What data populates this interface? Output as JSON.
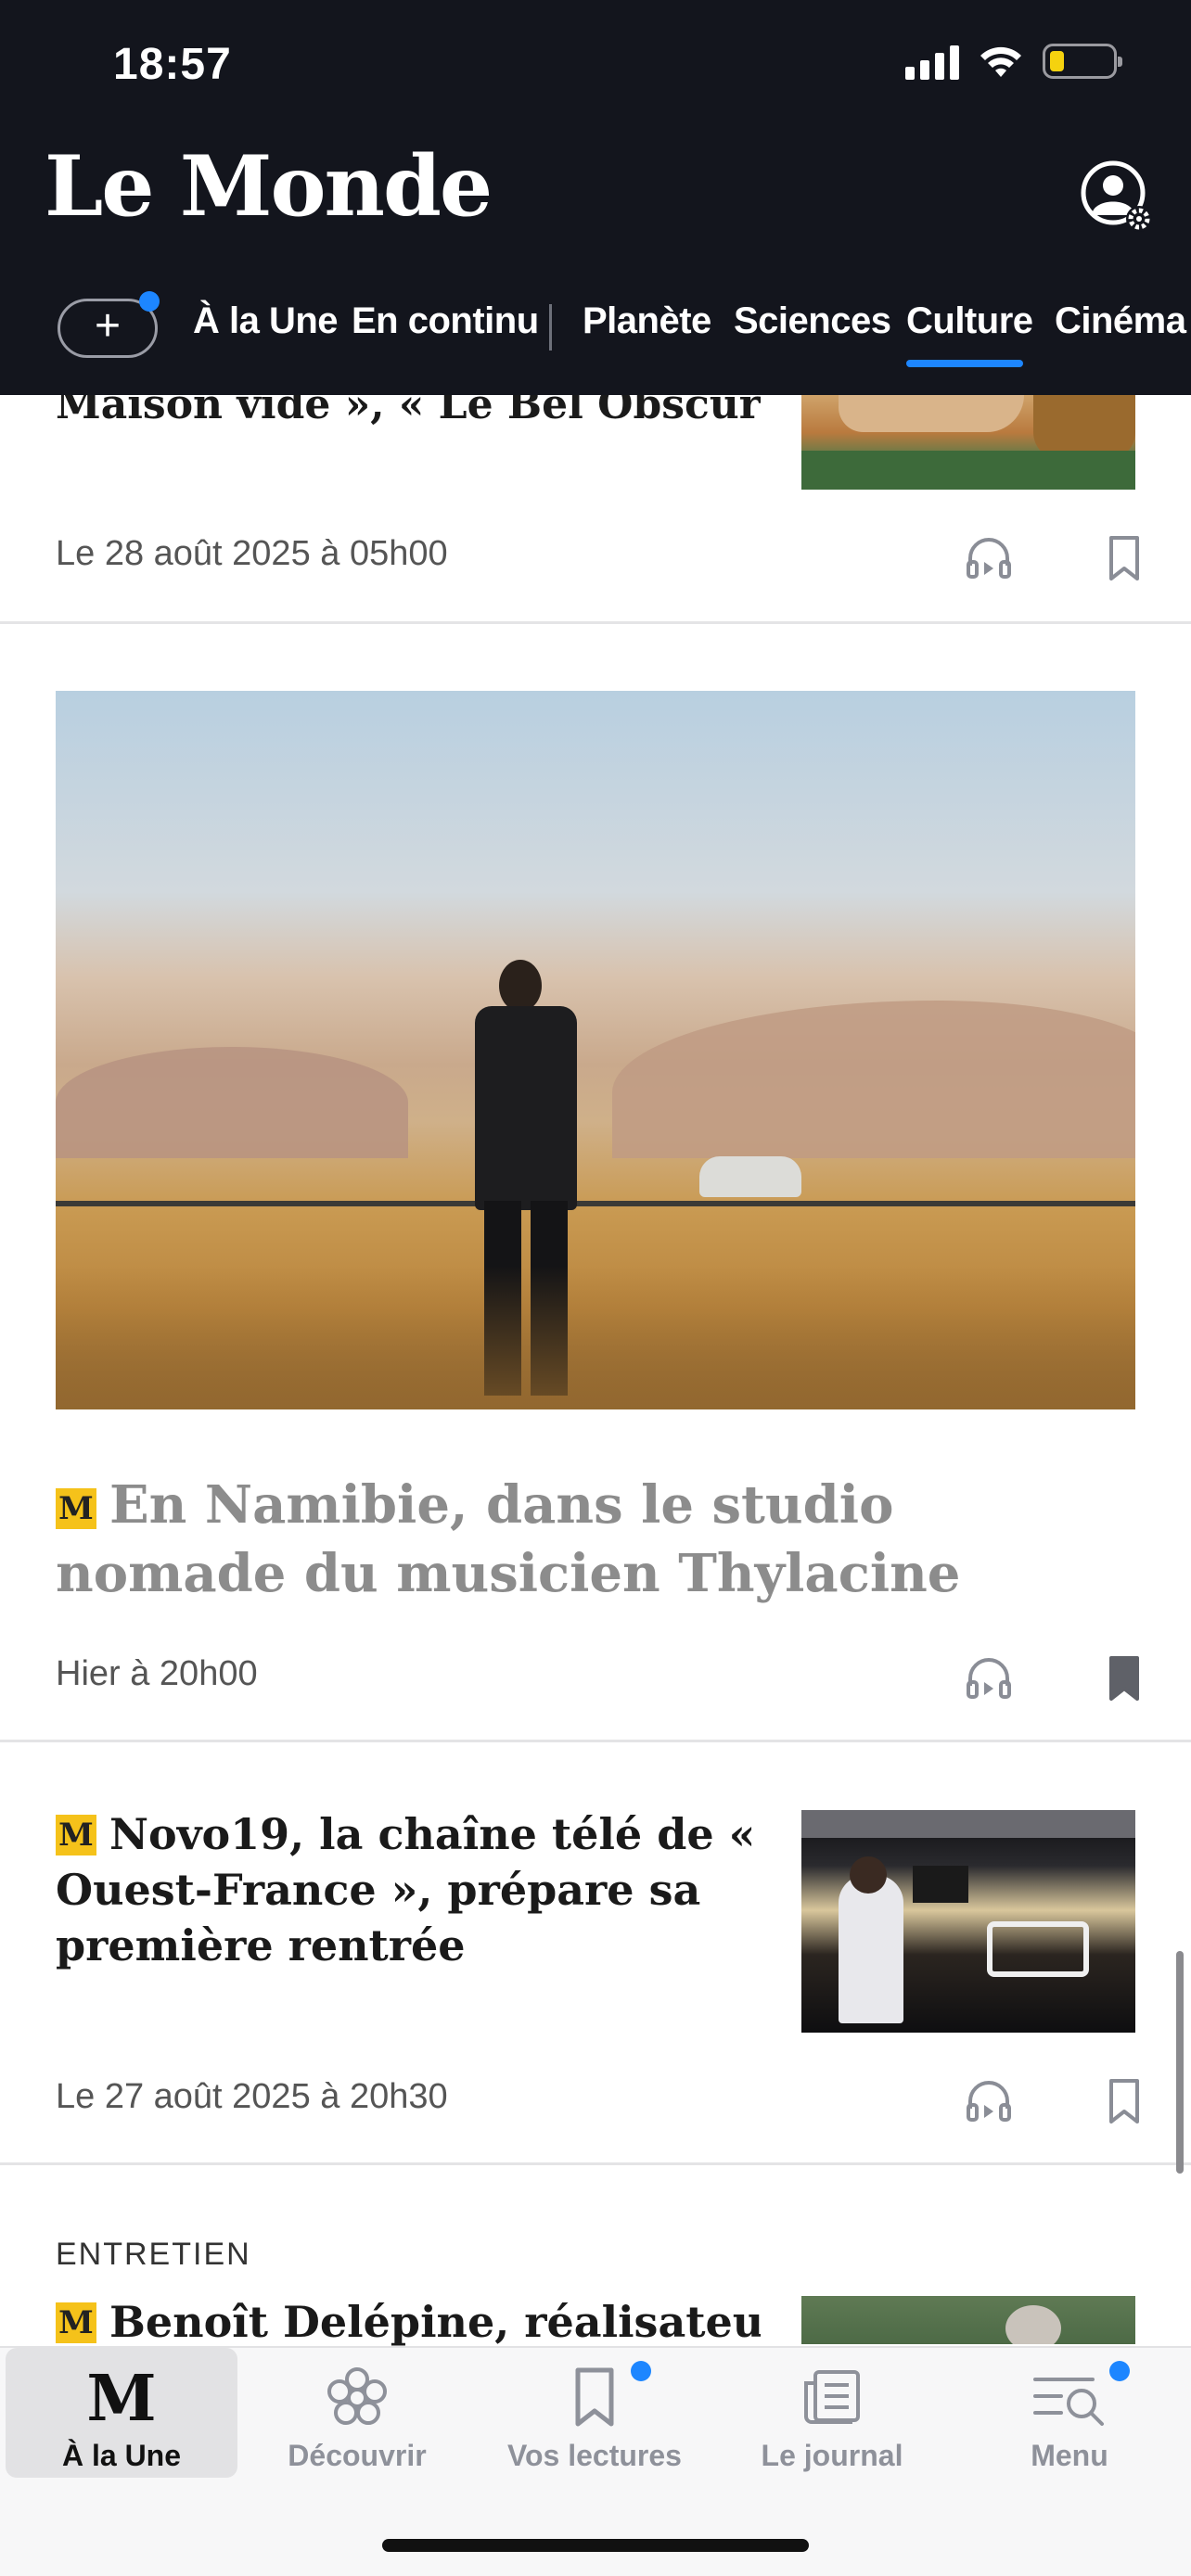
{
  "status_bar": {
    "time": "18:57"
  },
  "header": {
    "logo": "Le Monde",
    "nav": [
      {
        "label": "À la Une"
      },
      {
        "label": "En continu"
      },
      {
        "label": "Planète"
      },
      {
        "label": "Sciences"
      },
      {
        "label": "Culture",
        "active": true
      },
      {
        "label": "Cinéma"
      }
    ],
    "plus_label": "+"
  },
  "articles": [
    {
      "title": "Maison vide », « Le Bel Obscur »…",
      "date": "Le 28 août 2025 à 05h00",
      "bookmarked": false
    },
    {
      "title": "En Namibie, dans le studio nomade du musicien Thylacine",
      "badge": "M",
      "date": "Hier à 20h00",
      "bookmarked": true
    },
    {
      "title": "Novo19, la chaîne télé de « Ouest-France », prépare sa première rentrée",
      "badge": "M",
      "date": "Le 27 août 2025 à 20h30",
      "bookmarked": false
    },
    {
      "kicker": "ENTRETIEN",
      "title": "Benoît Delépine, réalisateur",
      "badge": "M"
    }
  ],
  "tabbar": {
    "items": [
      {
        "label": "À la Une",
        "icon": "le-monde-m-icon",
        "active": true
      },
      {
        "label": "Découvrir",
        "icon": "flower-icon"
      },
      {
        "label": "Vos lectures",
        "icon": "bookmark-icon",
        "dot": true
      },
      {
        "label": "Le journal",
        "icon": "newspaper-icon"
      },
      {
        "label": "Menu",
        "icon": "menu-search-icon",
        "dot": true
      }
    ]
  },
  "colors": {
    "header_bg": "#13151d",
    "accent": "#1d86ff",
    "badge": "#f5c21a"
  }
}
